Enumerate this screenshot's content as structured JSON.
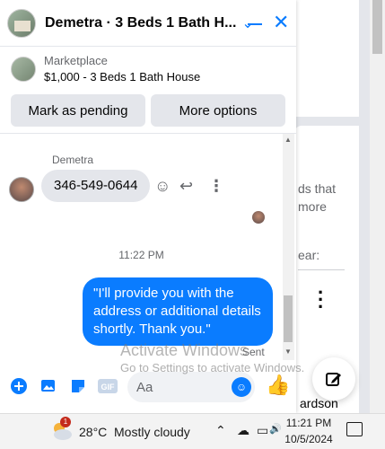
{
  "chat": {
    "header_title": "Demetra · 3 Beds 1 Bath H...",
    "listing_source": "Marketplace",
    "listing_title": "$1,000 - 3 Beds 1 Bath House",
    "mark_pending": "Mark as pending",
    "more_options": "More options",
    "sender_name": "Demetra",
    "incoming_message": "346-549-0644",
    "timestamp": "11:22 PM",
    "outgoing_message": "\"I'll provide you with the address or additional details shortly. Thank you.\"",
    "sent_status": "Sent",
    "composer_placeholder": "Aa"
  },
  "background": {
    "text_1": "ds that",
    "text_2": "more",
    "text_3": "ear:",
    "text_4": "ardson"
  },
  "watermark": {
    "title": "Activate Windows",
    "subtitle": "Go to Settings to activate Windows."
  },
  "taskbar": {
    "weather_badge": "1",
    "temperature": "28°C",
    "condition": "Mostly cloudy",
    "time": "11:21 PM",
    "date": "10/5/2024"
  },
  "colors": {
    "messenger_blue": "#0a7cff",
    "bubble_gray": "#e4e6eb"
  }
}
